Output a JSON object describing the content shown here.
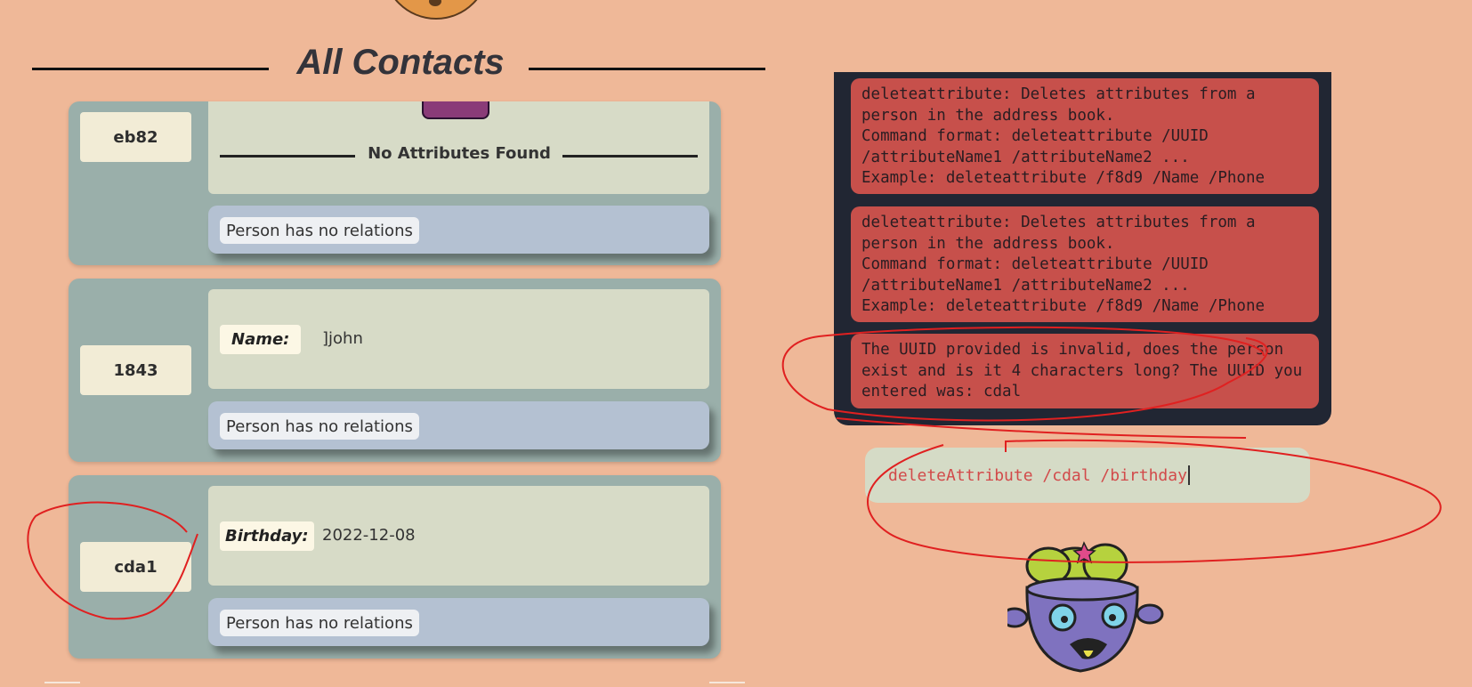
{
  "header": {
    "title": "All Contacts"
  },
  "contacts": [
    {
      "uuid": "eb82",
      "no_attributes_label": "No Attributes Found",
      "relations": "Person has no relations"
    },
    {
      "uuid": "1843",
      "attribute": {
        "label": "Name:",
        "value": "]john"
      },
      "relations": "Person has no relations"
    },
    {
      "uuid": "cda1",
      "attribute": {
        "label": "Birthday:",
        "value": "2022-12-08"
      },
      "relations": "Person has no relations"
    }
  ],
  "results": [
    {
      "text": "deleteattribute: Deletes attributes from a person in the address book.\nCommand format:  deleteattribute /UUID /attributeName1 /attributeName2 ...\nExample: deleteattribute /f8d9 /Name /Phone"
    },
    {
      "text": "deleteattribute: Deletes attributes from a person in the address book.\nCommand format:  deleteattribute /UUID /attributeName1 /attributeName2 ...\nExample: deleteattribute /f8d9 /Name /Phone"
    },
    {
      "text": "The UUID provided is invalid, does the person exist and is it 4 characters long? The UUID you entered was: cdal"
    }
  ],
  "command": {
    "value": "deleteAttribute /cdal /birthday"
  },
  "icons": {
    "cookie": "cookie-icon",
    "zombie": "zombie-mascot-icon",
    "avatar": "mascot-avatar-icon"
  },
  "colors": {
    "background": "#efb898",
    "card": "#9aafaa",
    "result_panel": "#212633",
    "error_message": "#c7504b",
    "annotation": "#e02020"
  }
}
